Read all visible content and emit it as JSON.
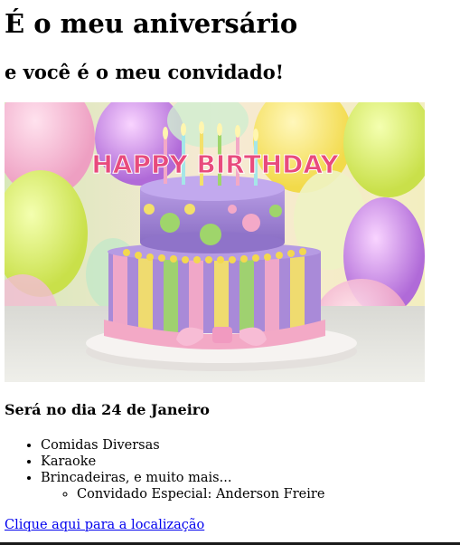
{
  "page": {
    "title": "É o meu aniversário",
    "subtitle": "e você é o meu convidado!",
    "image": {
      "banner_text": "HAPPY BIRTHDAY",
      "colors": {
        "frosting_top": "#9b7fd1",
        "frosting_bottom": "#a98ad8",
        "plate": "#f4f0ee",
        "ribbon": "#f3a9c6",
        "dots": "#9dd46a"
      }
    },
    "date_heading": "Será no dia 24 de Janeiro",
    "items": [
      "Comidas Diversas",
      "Karaoke",
      "Brincadeiras, e muito mais..."
    ],
    "sub_items": [
      "Convidado Especial: Anderson Freire"
    ],
    "location_link": "Clique aqui para a localização"
  }
}
